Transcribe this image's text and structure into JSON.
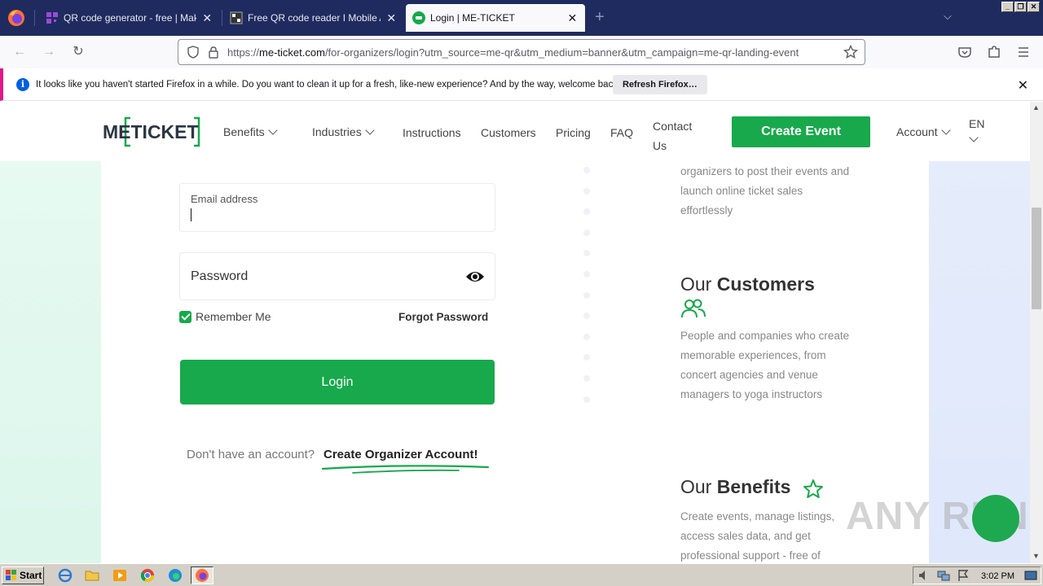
{
  "browser": {
    "tabs": [
      {
        "title": "QR code generator - free | Make Cu",
        "active": false
      },
      {
        "title": "Free QR code reader I Mobile App",
        "active": false
      },
      {
        "title": "Login | ME-TICKET",
        "active": true
      }
    ],
    "new_tab_label": "+",
    "url_scheme": "https://",
    "url_host": "me-ticket.com",
    "url_path": "/for-organizers/login?utm_source=me-qr&utm_medium=banner&utm_campaign=me-qr-landing-event",
    "notification": {
      "message": "It looks like you haven't started Firefox in a while. Do you want to clean it up for a fresh, like-new experience? And by the way, welcome back!",
      "button_label": "Refresh Firefox…"
    }
  },
  "site": {
    "logo_text": "METICKET",
    "nav": {
      "benefits": "Benefits",
      "industries": "Industries",
      "instructions": "Instructions",
      "customers": "Customers",
      "pricing": "Pricing",
      "faq": "FAQ",
      "contact_line1": "Contact",
      "contact_line2": "Us",
      "create_event": "Create Event",
      "account": "Account",
      "language": "EN"
    },
    "form": {
      "email_label": "Email address",
      "password_placeholder": "Password",
      "remember_me": "Remember Me",
      "forgot_password": "Forgot Password",
      "login_button": "Login",
      "no_account_text": "Don't have an account?",
      "create_account_link": "Create Organizer Account!"
    },
    "features": {
      "organizers_text": "organizers to post their events and launch online ticket sales effortlessly",
      "customers_title_prefix": "Our",
      "customers_title_bold": "Customers",
      "customers_text": "People and companies who create memorable experiences, from concert agencies and venue managers to yoga instructors",
      "benefits_title_prefix": "Our",
      "benefits_title_bold": "Benefits",
      "benefits_text": "Create events, manage listings, access sales data, and get professional support - free of"
    },
    "brand_color": "#17a94b"
  },
  "watermark": {
    "text": "ANY RUN"
  },
  "taskbar": {
    "start_label": "Start",
    "clock": "3:02 PM"
  }
}
